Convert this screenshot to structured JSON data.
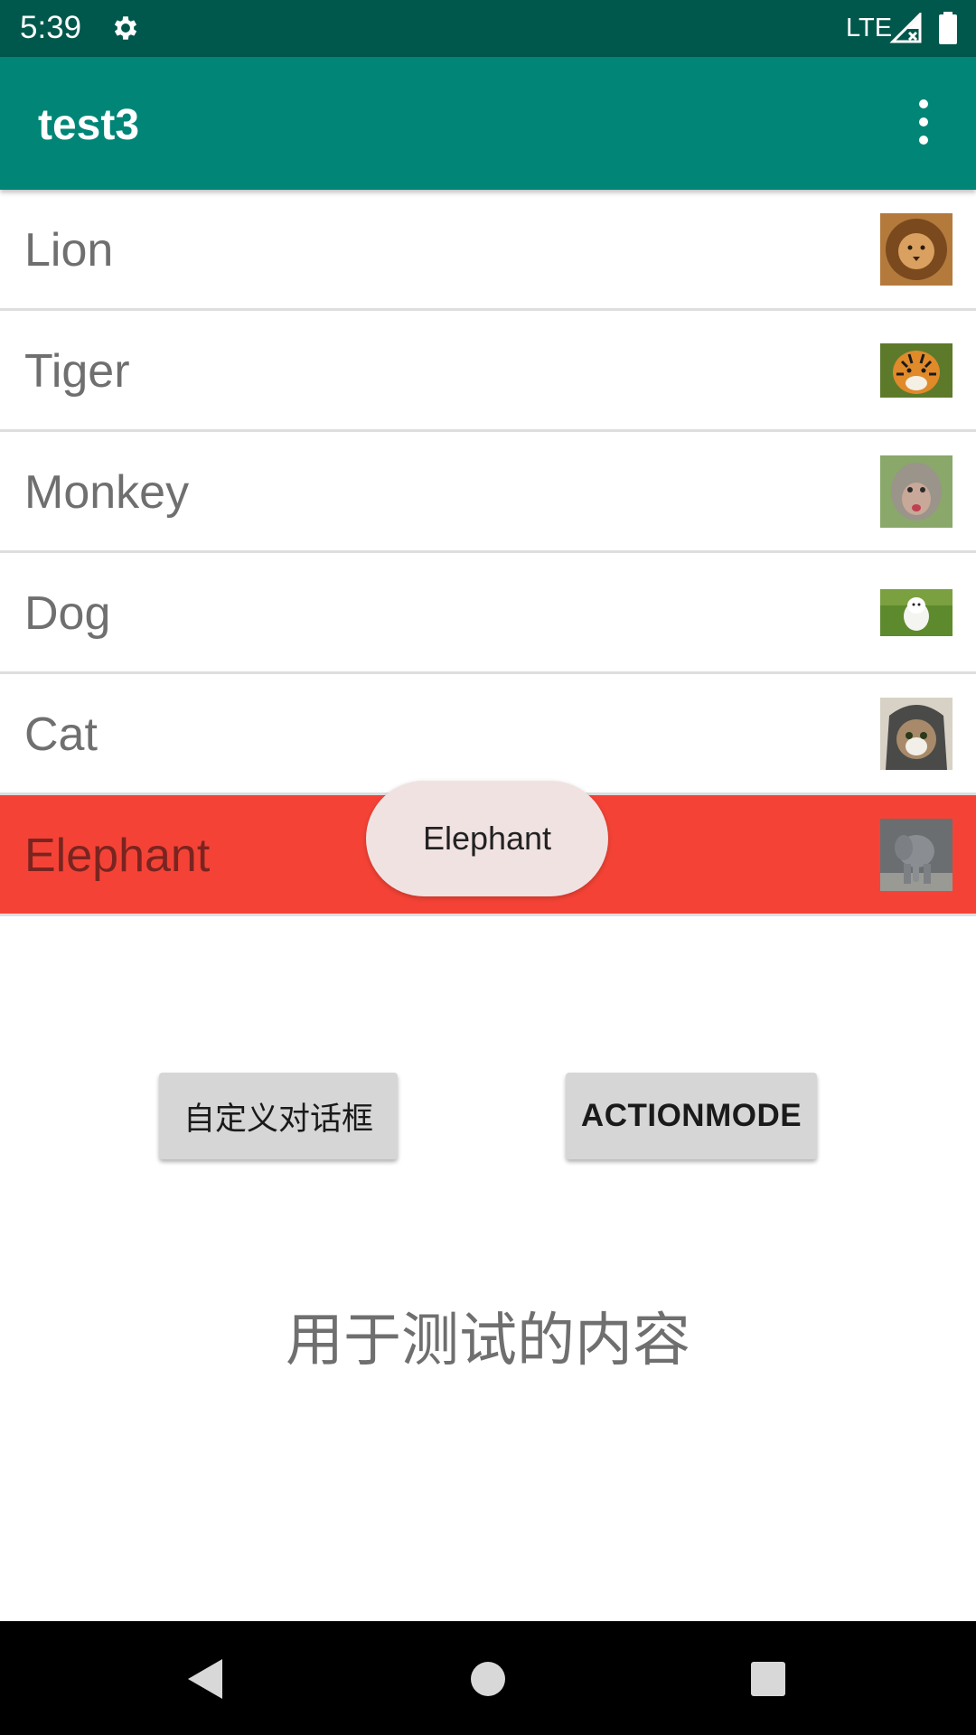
{
  "status_bar": {
    "time": "5:39",
    "network": "LTE",
    "icons": [
      "gear-icon",
      "signal-icon",
      "battery-icon"
    ]
  },
  "app_bar": {
    "title": "test3",
    "menu_icon": "overflow-menu-icon"
  },
  "list": {
    "items": [
      {
        "label": "Lion",
        "selected": false,
        "image": "lion-image"
      },
      {
        "label": "Tiger",
        "selected": false,
        "image": "tiger-image"
      },
      {
        "label": "Monkey",
        "selected": false,
        "image": "monkey-image"
      },
      {
        "label": "Dog",
        "selected": false,
        "image": "dog-image"
      },
      {
        "label": "Cat",
        "selected": false,
        "image": "cat-image"
      },
      {
        "label": "Elephant",
        "selected": true,
        "image": "elephant-image"
      }
    ]
  },
  "toast": {
    "text": "Elephant"
  },
  "buttons": {
    "dialog_label": "自定义对话框",
    "actionmode_label": "ACTIONMODE"
  },
  "content_text": "用于测试的内容",
  "nav_bar": {
    "icons": [
      "back-icon",
      "home-icon",
      "recents-icon"
    ]
  },
  "colors": {
    "status_bar": "#00574b",
    "app_bar": "#008577",
    "selected_row": "#f44336",
    "toast_bg": "#f1e2e2",
    "button_bg": "#d6d6d6"
  }
}
